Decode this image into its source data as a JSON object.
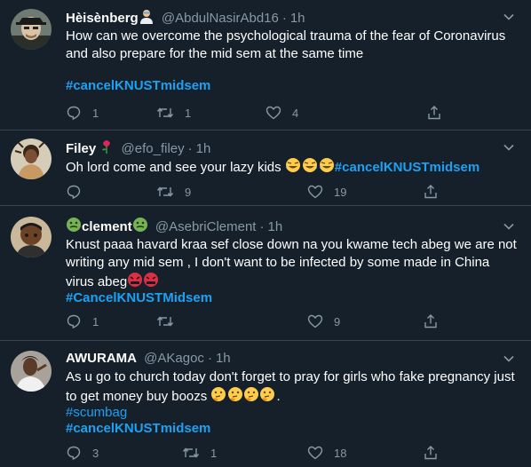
{
  "tweets": [
    {
      "name": "Hèisènberg",
      "handle": "@AbdulNasirAbd16",
      "time": "1h",
      "text": "How can we overcome the psychological trauma of the fear of Coronavirus and also prepare for the mid sem at the same time",
      "hashtag": "#cancelKNUSTmidsem",
      "replies": "1",
      "retweets": "1",
      "likes": "4"
    },
    {
      "name": "Filey",
      "handle": "@efo_filey",
      "time": "1h",
      "text": "Oh lord come and see your lazy kids",
      "hashtag": "#cancelKNUSTmidsem",
      "replies": "",
      "retweets": "9",
      "likes": "19"
    },
    {
      "name": "clement",
      "handle": "@AsebriClement",
      "time": "1h",
      "text": "Knust paaa havard kraa sef close down na you kwame tech abeg we are not writing any mid sem , I don't want to be infected by some made in China virus abeg",
      "hashtag": "#CancelKNUSTMidsem",
      "replies": "1",
      "retweets": "",
      "likes": "9"
    },
    {
      "name": "AWURAMA",
      "handle": "@AKagoc",
      "time": "1h",
      "text": "As u go to church today don't forget to pray for girls who fake pregnancy just to get money buy boozs",
      "text_end": ".",
      "hashtag1": "#scumbag",
      "hashtag": "#cancelKNUSTmidsem",
      "replies": "3",
      "retweets": "1",
      "likes": "18"
    }
  ],
  "separator": "·",
  "colors": {
    "background": "#15202b",
    "secondary_text": "#8899a6",
    "link": "#1da1f2",
    "divider": "#38444d"
  }
}
